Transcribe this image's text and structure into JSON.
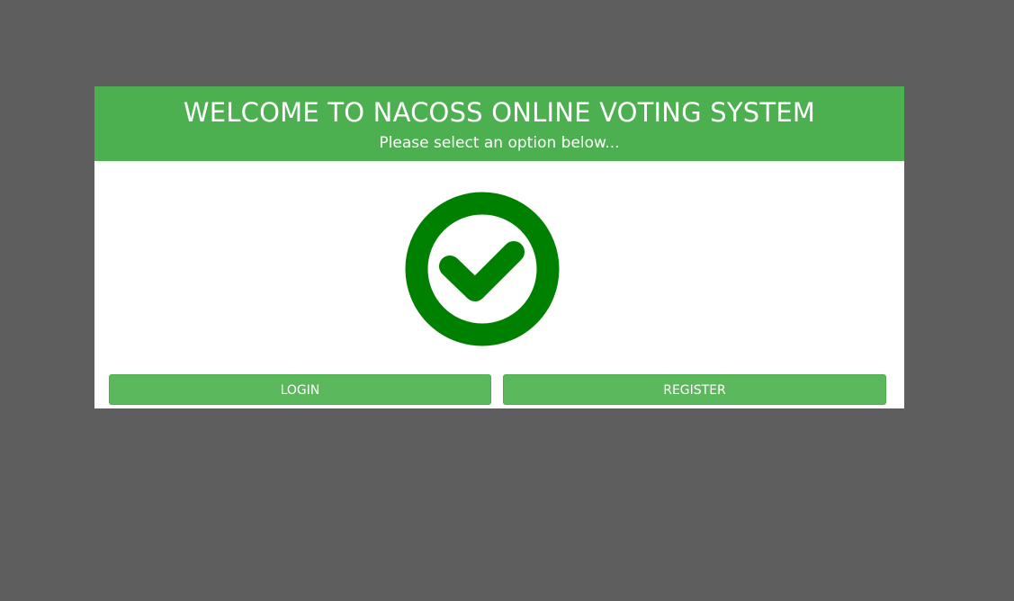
{
  "header": {
    "title": "WELCOME TO NACOSS ONLINE VOTING SYSTEM",
    "subtitle": "Please select an option below..."
  },
  "logo": {
    "icon": "check-circle-icon",
    "color": "#008000"
  },
  "actions": {
    "login_label": "LOGIN",
    "register_label": "REGISTER"
  },
  "colors": {
    "header_bg": "#4caf50",
    "button_bg": "#5cb85c",
    "page_bg": "#5e5e5e"
  }
}
